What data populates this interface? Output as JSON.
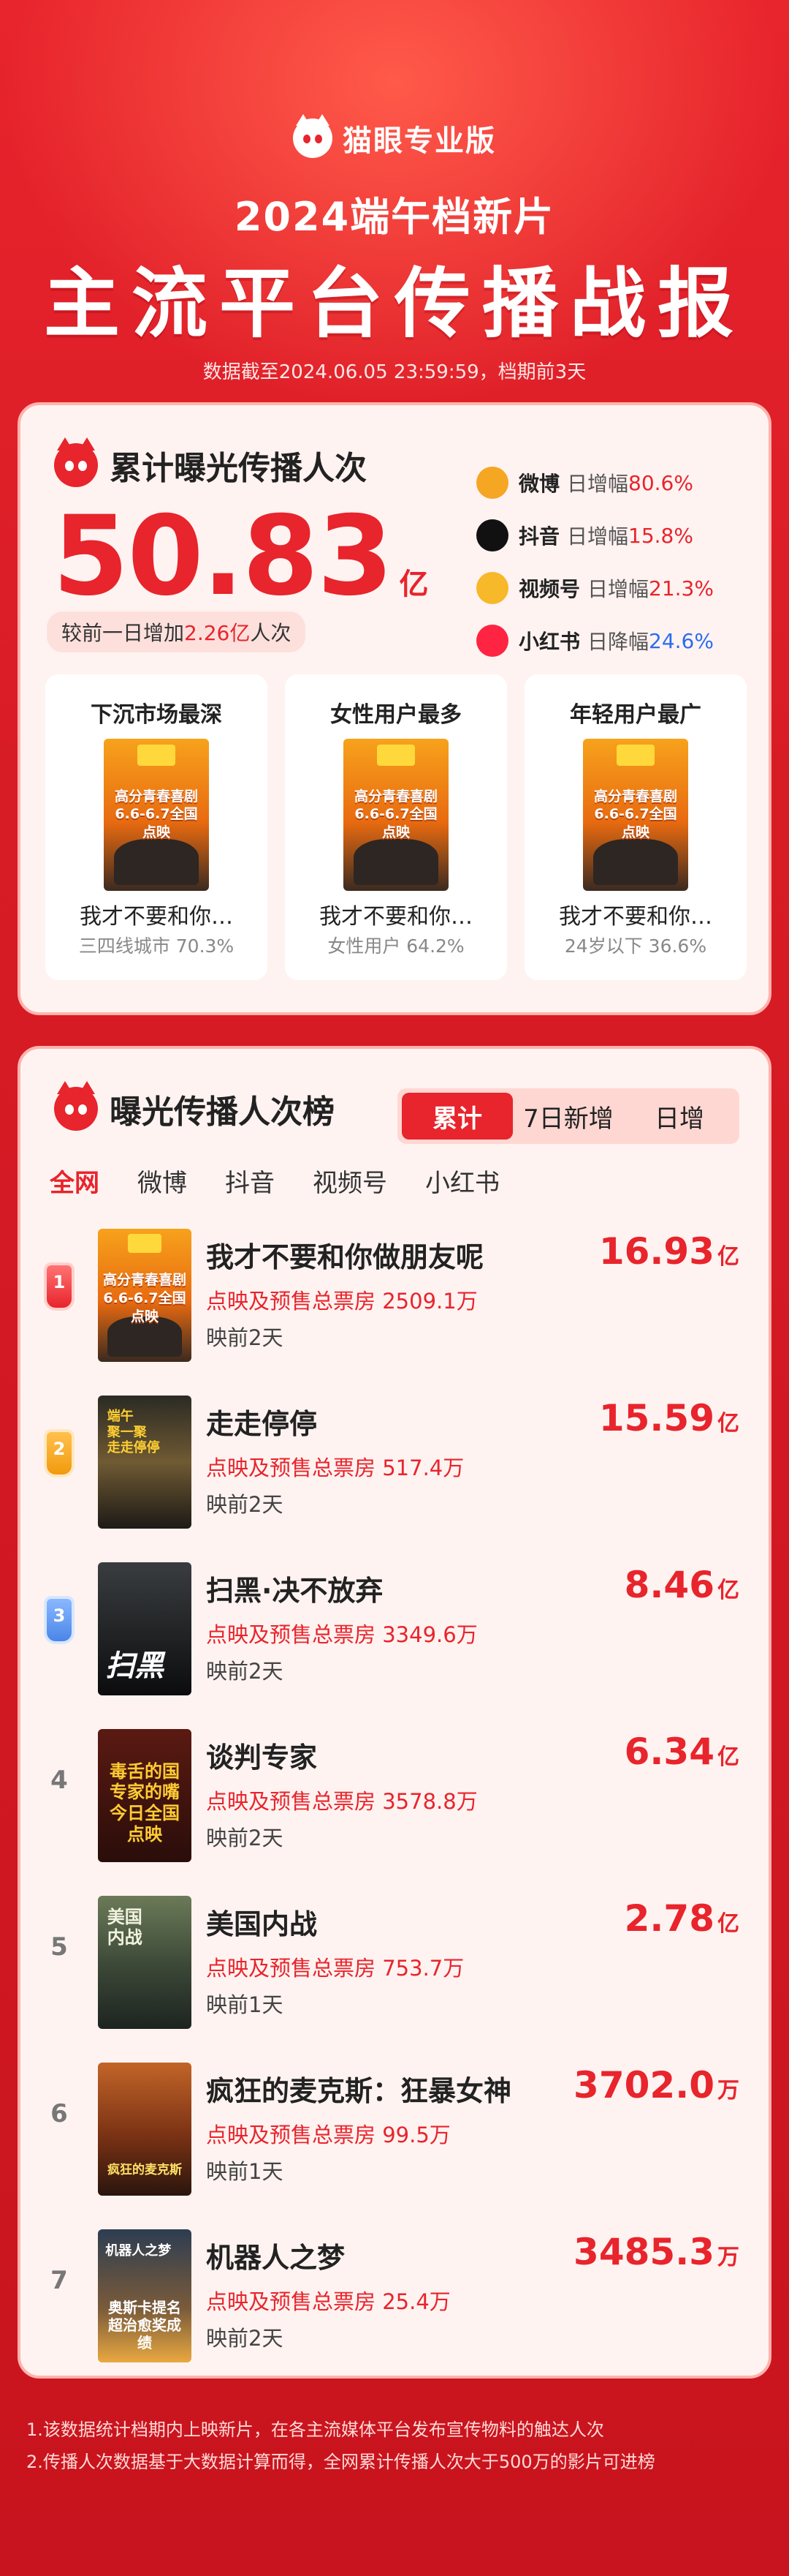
{
  "header": {
    "brand": "猫眼专业版",
    "subtitle": "2024端午档新片",
    "title": "主流平台传播战报",
    "dateline": "数据截至2024.06.05 23:59:59，档期前3天"
  },
  "summary": {
    "heading": "累计曝光传播人次",
    "value": "50.83",
    "unit": "亿",
    "increase_prefix": "较前一日增加",
    "increase_value": "2.26亿",
    "increase_suffix": "人次",
    "platforms": [
      {
        "name": "微博",
        "label": "日增幅",
        "value": "80.6%",
        "trend": "up",
        "icon": "weibo-icon",
        "color": "#f5a623"
      },
      {
        "name": "抖音",
        "label": "日增幅",
        "value": "15.8%",
        "trend": "up",
        "icon": "douyin-icon",
        "color": "#111111"
      },
      {
        "name": "视频号",
        "label": "日增幅",
        "value": "21.3%",
        "trend": "up",
        "icon": "channels-icon",
        "color": "#f7b829"
      },
      {
        "name": "小红书",
        "label": "日降幅",
        "value": "24.6%",
        "trend": "down",
        "icon": "xiaohongshu-icon",
        "color": "#ff2442"
      }
    ],
    "tiles": [
      {
        "title": "下沉市场最深",
        "film": "我才不要和你…",
        "stat": "三四线城市 70.3%"
      },
      {
        "title": "女性用户最多",
        "film": "我才不要和你…",
        "stat": "女性用户 64.2%"
      },
      {
        "title": "年轻用户最广",
        "film": "我才不要和你…",
        "stat": "24岁以下 36.6%"
      }
    ],
    "poster_text": "高分青春喜剧\n6.6-6.7全国点映"
  },
  "ranking": {
    "heading": "曝光传播人次榜",
    "segments": [
      "累计",
      "7日新增",
      "日增"
    ],
    "active_segment": 0,
    "platform_tabs": [
      "全网",
      "微博",
      "抖音",
      "视频号",
      "小红书"
    ],
    "active_tab": 0,
    "films": [
      {
        "rank": "1",
        "name": "我才不要和你做朋友呢",
        "box_label": "点映及预售总票房",
        "box": "2509.1万",
        "days": "映前2天",
        "value": "16.93",
        "unit": "亿",
        "poster_text": "高分青春喜剧\n6.6-6.7全国点映"
      },
      {
        "rank": "2",
        "name": "走走停停",
        "box_label": "点映及预售总票房",
        "box": "517.4万",
        "days": "映前2天",
        "value": "15.59",
        "unit": "亿",
        "poster_text": "端午\n聚一聚\n走走停停"
      },
      {
        "rank": "3",
        "name": "扫黑·决不放弃",
        "box_label": "点映及预售总票房",
        "box": "3349.6万",
        "days": "映前2天",
        "value": "8.46",
        "unit": "亿",
        "poster_text": "扫黑"
      },
      {
        "rank": "4",
        "name": "谈判专家",
        "box_label": "点映及预售总票房",
        "box": "3578.8万",
        "days": "映前2天",
        "value": "6.34",
        "unit": "亿",
        "poster_text": "毒舌的国\n专家的嘴\n今日全国点映"
      },
      {
        "rank": "5",
        "name": "美国内战",
        "box_label": "点映及预售总票房",
        "box": "753.7万",
        "days": "映前1天",
        "value": "2.78",
        "unit": "亿",
        "poster_text": "美国\n内战"
      },
      {
        "rank": "6",
        "name": "疯狂的麦克斯：狂暴女神",
        "box_label": "点映及预售总票房",
        "box": "99.5万",
        "days": "映前1天",
        "value": "3702.0",
        "unit": "万",
        "poster_text": "疯狂的麦克斯"
      },
      {
        "rank": "7",
        "name": "机器人之梦",
        "box_label": "点映及预售总票房",
        "box": "25.4万",
        "days": "映前2天",
        "value": "3485.3",
        "unit": "万",
        "poster_text": "奥斯卡提名\n超治愈奖成绩",
        "poster_top": "机器人之梦"
      }
    ]
  },
  "notes": [
    "1.该数据统计档期内上映新片，在各主流媒体平台发布宣传物料的触达人次",
    "2.传播人次数据基于大数据计算而得，全网累计传播人次大于500万的影片可进榜"
  ],
  "colors": {
    "accent": "#e8242c",
    "down": "#2a6cf0"
  }
}
